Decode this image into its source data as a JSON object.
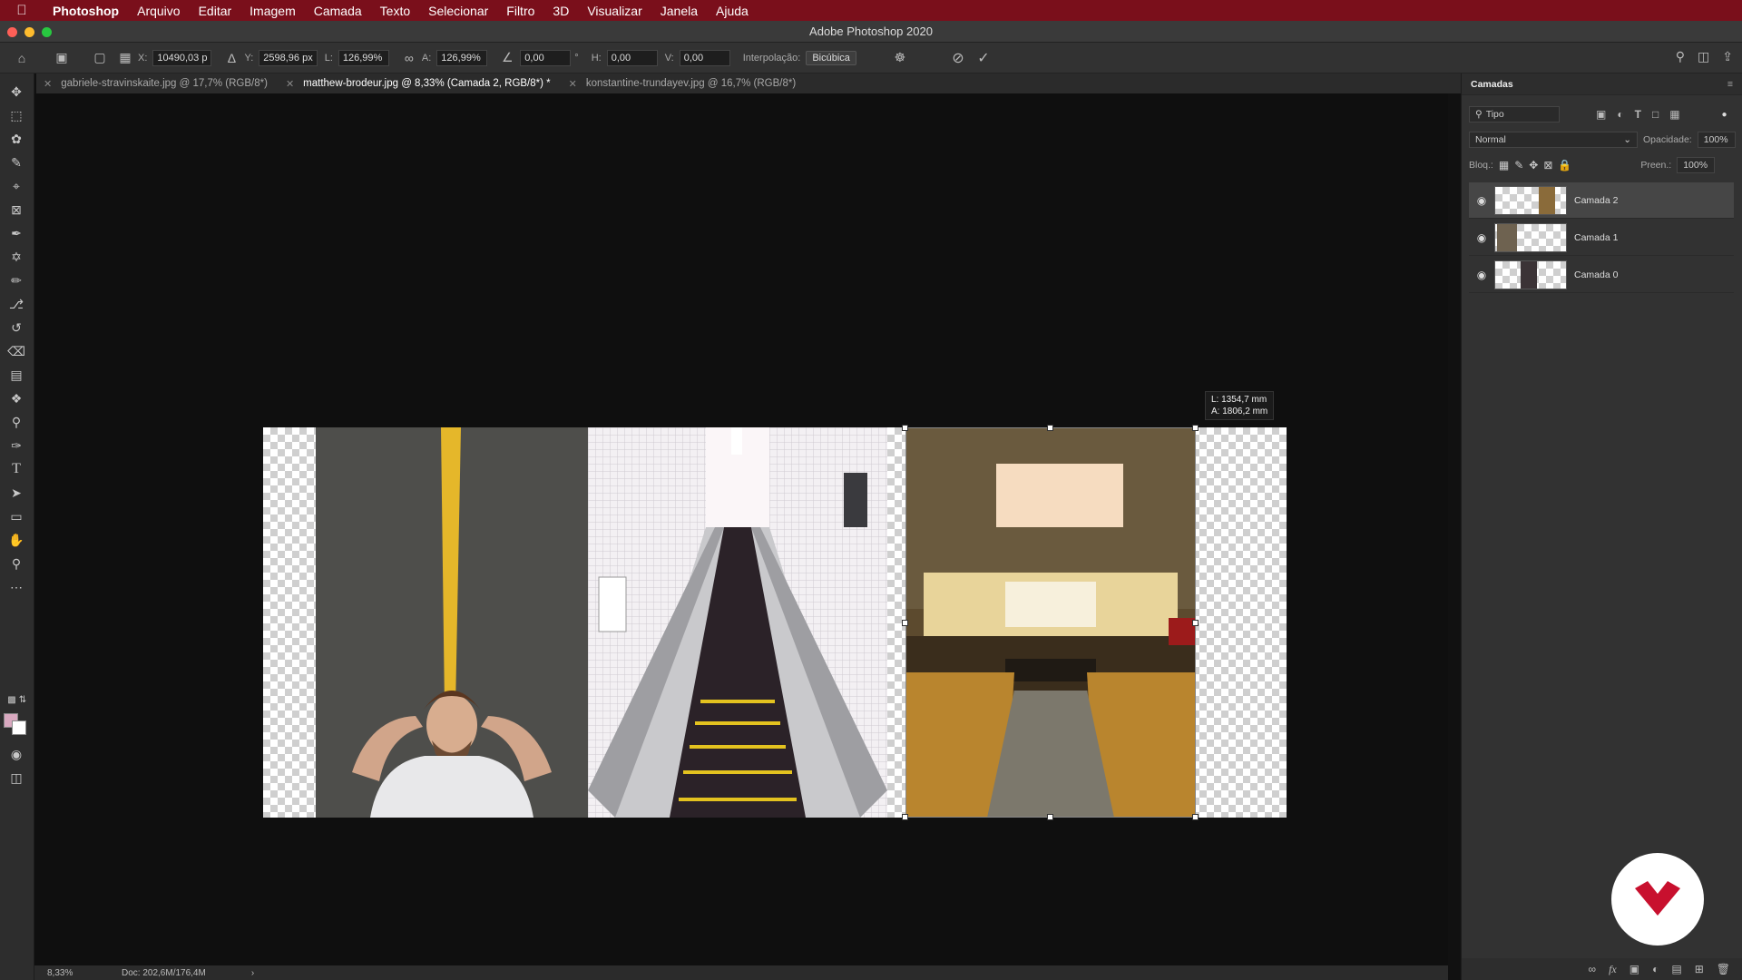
{
  "menubar": {
    "apple": "",
    "items": [
      "Photoshop",
      "Arquivo",
      "Editar",
      "Imagem",
      "Camada",
      "Texto",
      "Selecionar",
      "Filtro",
      "3D",
      "Visualizar",
      "Janela",
      "Ajuda"
    ]
  },
  "window": {
    "title": "Adobe Photoshop 2020"
  },
  "options": {
    "x_label": "X:",
    "x_value": "10490,03 p",
    "y_label": "Y:",
    "y_value": "2598,96 px",
    "w_label": "L:",
    "w_value": "126,99%",
    "h_label": "A:",
    "h_value": "126,99%",
    "angle_value": "0,00",
    "hskew_label": "H:",
    "hskew_value": "0,00",
    "vskew_label": "V:",
    "vskew_value": "0,00",
    "interp_label": "Interpolação:",
    "interp_value": "Bicúbica"
  },
  "tabs": [
    {
      "label": "gabriele-stravinskaite.jpg @ 17,7% (RGB/8*)"
    },
    {
      "label": "matthew-brodeur.jpg @ 8,33% (Camada 2, RGB/8*) *"
    },
    {
      "label": "konstantine-trundayev.jpg @ 16,7% (RGB/8*)"
    }
  ],
  "tooltip": {
    "line1": "L: 1354,7 mm",
    "line2": "A: 1806,2 mm"
  },
  "status": {
    "zoom": "8,33%",
    "doc": "Doc: 202,6M/176,4M",
    "arrow": "›"
  },
  "layers_panel": {
    "title": "Camadas",
    "filter": "Tipo",
    "blend_mode": "Normal",
    "opacity_label": "Opacidade:",
    "opacity_value": "100%",
    "lock_label": "Bloq.:",
    "fill_label": "Preen.:",
    "fill_value": "100%",
    "layers": [
      {
        "name": "Camada 2"
      },
      {
        "name": "Camada 1"
      },
      {
        "name": "Camada 0"
      }
    ]
  },
  "colors": {
    "menubar": "#7a0f1b",
    "fg_swatch": "#d9a9c0",
    "logo_red": "#c8102e"
  }
}
